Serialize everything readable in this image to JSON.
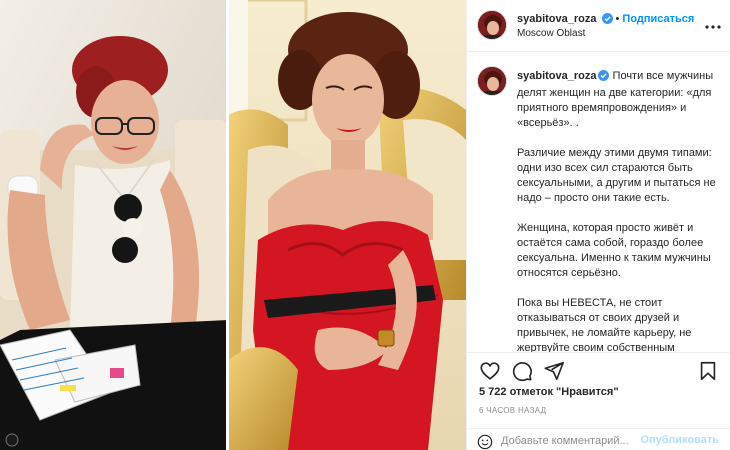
{
  "post": {
    "username": "syabitova_roza",
    "follow_label": "Подписаться",
    "location": "Moscow Oblast",
    "caption_paragraphs": [
      "Почти все мужчины делят женщин на две категории: «для приятного времяпровождения» и «всерьёз». .",
      "Различие между этими двумя типами: одни изо всех сил стараются быть сексуальными, а другим и пытаться не надо – просто они такие есть.",
      "Женщина, которая просто живёт и остаётся сама собой, гораздо более сексуальна. Именно к таким мужчины относятся серьёзно.",
      "Пока вы НЕВЕСТА, не стоит отказываться от своих друзей и привычек, не ломайте карьеру, не жертвуйте своим собственным"
    ],
    "likes_text": "5 722 отметок \"Нравится\"",
    "time_ago": "6 ЧАСОВ НАЗАД",
    "comment_placeholder": "Добавьте комментарий...",
    "publish_label": "Опубликовать"
  },
  "icons": {
    "header": [
      "verified-badge-icon",
      "more-options-icon"
    ],
    "actions": [
      "heart-icon",
      "comment-icon",
      "share-icon",
      "bookmark-icon"
    ],
    "comment": [
      "emoji-icon"
    ]
  },
  "colors": {
    "accent": "#0095f6",
    "verified": "#3897f0",
    "publish_disabled": "#b2dffc",
    "muted": "#8e8e8e",
    "border": "#efefef"
  }
}
